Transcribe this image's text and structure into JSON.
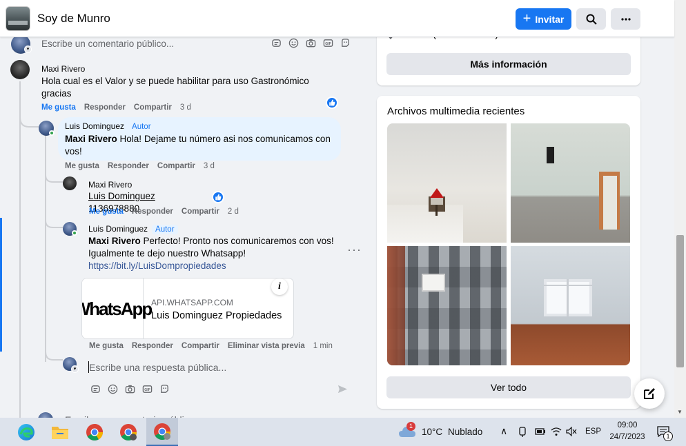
{
  "header": {
    "group_name": "Soy de Munro",
    "invite_label": "Invitar"
  },
  "top_comment_box": {
    "placeholder": "Escribe un comentario público..."
  },
  "comments": [
    {
      "author": "Maxi Rivero",
      "text": "Hola cual es el Valor y se puede habilitar para uso Gastronómico gracias",
      "actions": {
        "like": "Me gusta",
        "reply": "Responder",
        "share": "Compartir",
        "time": "3 d"
      }
    },
    {
      "author": "Luis Dominguez",
      "badge": "Autor",
      "mention": "Maxi Rivero",
      "text": "Hola! Dejame tu número asi nos comunicamos con vos!",
      "actions": {
        "like": "Me gusta",
        "reply": "Responder",
        "share": "Compartir",
        "time": "3 d"
      }
    },
    {
      "author": "Maxi Rivero",
      "mention": "Luis Dominguez",
      "text": "1136978880",
      "actions": {
        "like": "Me gusta",
        "reply": "Responder",
        "share": "Compartir",
        "time": "2 d"
      }
    },
    {
      "author": "Luis Dominguez",
      "badge": "Autor",
      "mention": "Maxi Rivero",
      "text": "Perfecto! Pronto nos comunicaremos con vos! Igualmente te dejo nuestro Whatsapp!",
      "link": "https://bit.ly/LuisDompropiedades",
      "preview": {
        "image_text": "WhatsApp",
        "domain": "API.WHATSAPP.COM",
        "title": "Luis Dominguez Propiedades"
      },
      "actions": {
        "like": "Me gusta",
        "reply": "Responder",
        "share": "Compartir",
        "remove_preview": "Eliminar vista previa",
        "time": "1 min"
      }
    }
  ],
  "reply_box": {
    "placeholder": "Escribe una respuesta pública..."
  },
  "bottom_comment_box": {
    "placeholder": "Escribe un comentario público..."
  },
  "sidebar": {
    "location_partial": "Munro (Buenos Aires)",
    "more_info_label": "Más información",
    "media_title": "Archivos multimedia recientes",
    "see_all_label": "Ver todo"
  },
  "taskbar": {
    "weather_temp": "10°C",
    "weather_desc": "Nublado",
    "weather_badge": "1",
    "language": "ESP",
    "time": "09:00",
    "date": "24/7/2023",
    "notification_count": "1"
  }
}
